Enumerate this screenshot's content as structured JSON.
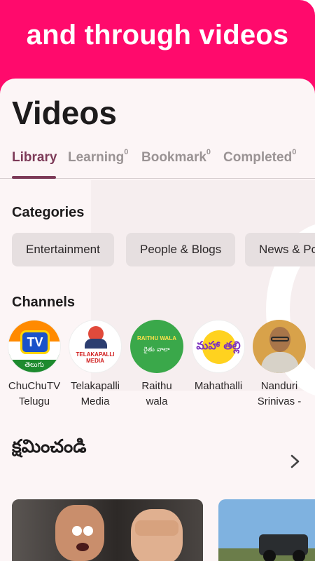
{
  "banner": {
    "title": "and through videos"
  },
  "page": {
    "title": "Videos"
  },
  "tabs": [
    {
      "label": "Library",
      "count": ""
    },
    {
      "label": "Learning",
      "count": "0"
    },
    {
      "label": "Bookmark",
      "count": "0"
    },
    {
      "label": "Completed",
      "count": "0"
    }
  ],
  "categories": {
    "title": "Categories",
    "items": [
      "Entertainment",
      "People & Blogs",
      "News & Po"
    ]
  },
  "channels": {
    "title": "Channels",
    "items": [
      {
        "name_line1": "ChuChuTV",
        "name_line2": "Telugu",
        "logo_text": "TV",
        "logo_sub": "తెలుగు"
      },
      {
        "name_line1": "Telakapalli",
        "name_line2": "Media",
        "logo_text": "TELAKAPALLI MEDIA"
      },
      {
        "name_line1": "Raithu",
        "name_line2": "wala",
        "logo_text": "RAITHU WALA",
        "logo_sub": "రైతు వాలా"
      },
      {
        "name_line1": "Mahathalli",
        "name_line2": "",
        "logo_text": "మహా తల్లి"
      },
      {
        "name_line1": "Nanduri",
        "name_line2": "Srinivas -",
        "logo_text": ""
      }
    ]
  },
  "playlist": {
    "title": "క్షమించండి"
  },
  "colors": {
    "brand": "#ff0a6c",
    "accent": "#7d3a58",
    "chip": "#e6dfe0",
    "sheet": "#fcf5f6"
  }
}
